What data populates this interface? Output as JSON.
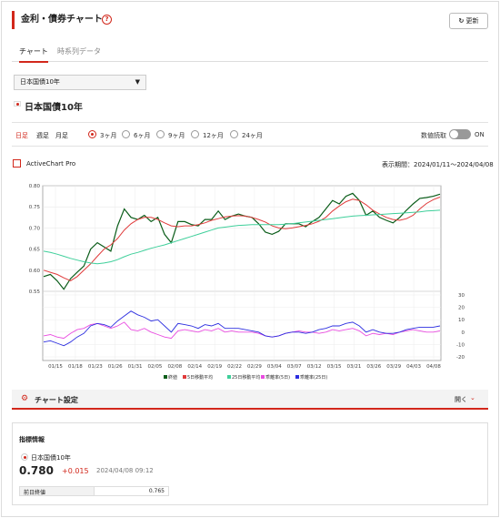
{
  "header": {
    "title": "金利・債券チャート",
    "help_icon": "?",
    "refresh_label": "更新"
  },
  "tabs": [
    {
      "label": "チャート",
      "active": true
    },
    {
      "label": "時系列データ",
      "active": false
    }
  ],
  "instrument_select": {
    "value": "日本国債10年"
  },
  "instrument_title": "日本国債10年",
  "period_types": [
    "日足",
    "週足",
    "月足"
  ],
  "ranges": [
    {
      "label": "3ヶ月",
      "selected": true
    },
    {
      "label": "6ヶ月",
      "selected": false
    },
    {
      "label": "9ヶ月",
      "selected": false
    },
    {
      "label": "12ヶ月",
      "selected": false
    },
    {
      "label": "24ヶ月",
      "selected": false
    }
  ],
  "value_readout": {
    "label": "数値読取",
    "state": "ON"
  },
  "activechart_label": "ActiveChart Pro",
  "display_period": "表示期間：2024/01/11〜2024/04/08",
  "chart_data": {
    "type": "line",
    "x": [
      "01/15",
      "01/18",
      "01/23",
      "01/26",
      "01/31",
      "02/05",
      "02/08",
      "02/14",
      "02/19",
      "02/22",
      "02/29",
      "03/04",
      "03/07",
      "03/12",
      "03/15",
      "03/21",
      "03/26",
      "03/29",
      "04/03",
      "04/08"
    ],
    "ylim": [
      0.55,
      0.8
    ],
    "yticks": [
      "0.80",
      "0.75",
      "0.70",
      "0.65",
      "0.60",
      "0.55"
    ],
    "y2ticks": [
      "30",
      "20",
      "10",
      "0",
      "-10",
      "-20"
    ],
    "price_series": [
      {
        "name": "終値",
        "color": "#0b5d1a",
        "values": [
          0.585,
          0.59,
          0.575,
          0.555,
          0.58,
          0.595,
          0.61,
          0.65,
          0.665,
          0.655,
          0.645,
          0.705,
          0.745,
          0.725,
          0.72,
          0.73,
          0.715,
          0.725,
          0.685,
          0.665,
          0.715,
          0.715,
          0.708,
          0.705,
          0.72,
          0.72,
          0.74,
          0.72,
          0.728,
          0.733,
          0.728,
          0.725,
          0.71,
          0.69,
          0.685,
          0.692,
          0.71,
          0.71,
          0.71,
          0.703,
          0.715,
          0.725,
          0.745,
          0.765,
          0.757,
          0.775,
          0.782,
          0.765,
          0.73,
          0.74,
          0.725,
          0.718,
          0.712,
          0.725,
          0.742,
          0.757,
          0.77,
          0.772,
          0.775,
          0.78
        ]
      },
      {
        "name": "5日移動平均",
        "color": "#e03b3b",
        "values": [
          0.6,
          0.595,
          0.59,
          0.582,
          0.575,
          0.585,
          0.6,
          0.615,
          0.633,
          0.65,
          0.66,
          0.675,
          0.695,
          0.71,
          0.72,
          0.725,
          0.725,
          0.72,
          0.712,
          0.705,
          0.703,
          0.705,
          0.705,
          0.708,
          0.712,
          0.718,
          0.722,
          0.726,
          0.728,
          0.729,
          0.728,
          0.725,
          0.72,
          0.714,
          0.705,
          0.7,
          0.698,
          0.7,
          0.703,
          0.706,
          0.71,
          0.716,
          0.725,
          0.74,
          0.752,
          0.762,
          0.768,
          0.765,
          0.755,
          0.742,
          0.733,
          0.725,
          0.72,
          0.718,
          0.722,
          0.73,
          0.745,
          0.758,
          0.767,
          0.773
        ]
      },
      {
        "name": "25日移動平均",
        "color": "#3ecf9a",
        "values": [
          0.645,
          0.642,
          0.638,
          0.633,
          0.628,
          0.624,
          0.62,
          0.617,
          0.615,
          0.617,
          0.62,
          0.625,
          0.632,
          0.638,
          0.642,
          0.647,
          0.652,
          0.656,
          0.66,
          0.665,
          0.67,
          0.675,
          0.68,
          0.685,
          0.69,
          0.695,
          0.7,
          0.702,
          0.704,
          0.706,
          0.707,
          0.708,
          0.708,
          0.708,
          0.708,
          0.708,
          0.709,
          0.71,
          0.712,
          0.714,
          0.716,
          0.718,
          0.72,
          0.722,
          0.724,
          0.726,
          0.728,
          0.729,
          0.73,
          0.731,
          0.732,
          0.733,
          0.734,
          0.735,
          0.736,
          0.737,
          0.738,
          0.74,
          0.741,
          0.742
        ]
      }
    ],
    "deviation_series": [
      {
        "name": "乖離率(5日)",
        "color": "#e94ce0",
        "values": [
          -3,
          -2,
          -4,
          -5,
          -1,
          2,
          3,
          6,
          7,
          5,
          3,
          5,
          8,
          2,
          1,
          3,
          0,
          -2,
          -4,
          -5,
          1,
          2,
          1,
          0,
          2,
          1,
          3,
          0,
          1,
          0,
          0,
          0,
          -1,
          -3,
          -4,
          -3,
          -1,
          0,
          1,
          0,
          0,
          -1,
          0,
          2,
          1,
          2,
          3,
          1,
          -3,
          -1,
          -2,
          -1,
          -2,
          0,
          1,
          2,
          1,
          0,
          0,
          1
        ]
      },
      {
        "name": "乖離率(25日)",
        "color": "#2c2ee0",
        "values": [
          -8,
          -7,
          -9,
          -11,
          -8,
          -4,
          -1,
          5,
          7,
          6,
          4,
          9,
          13,
          17,
          14,
          12,
          9,
          10,
          5,
          0,
          7,
          6,
          5,
          3,
          6,
          5,
          7,
          3,
          3,
          3,
          2,
          1,
          0,
          -3,
          -4,
          -3,
          -1,
          0,
          0,
          -1,
          0,
          2,
          3,
          5,
          5,
          7,
          8,
          5,
          0,
          2,
          0,
          -1,
          -1,
          0,
          2,
          3,
          4,
          4,
          4,
          5
        ]
      }
    ],
    "legend": [
      "終値",
      "5日移動平均",
      "25日移動平均",
      "乖離率(5日)",
      "乖離率(25日)"
    ]
  },
  "settings": {
    "label": "チャート設定",
    "open_label": "開く"
  },
  "indicator": {
    "heading": "指標情報",
    "name": "日本国債10年",
    "value": "0.780",
    "change": "+0.015",
    "timestamp": "2024/04/08 09:12",
    "prev_label": "前日終値",
    "prev_value": "0.765"
  },
  "colors": {
    "accent": "#d2271b",
    "change": "#d2271b"
  }
}
